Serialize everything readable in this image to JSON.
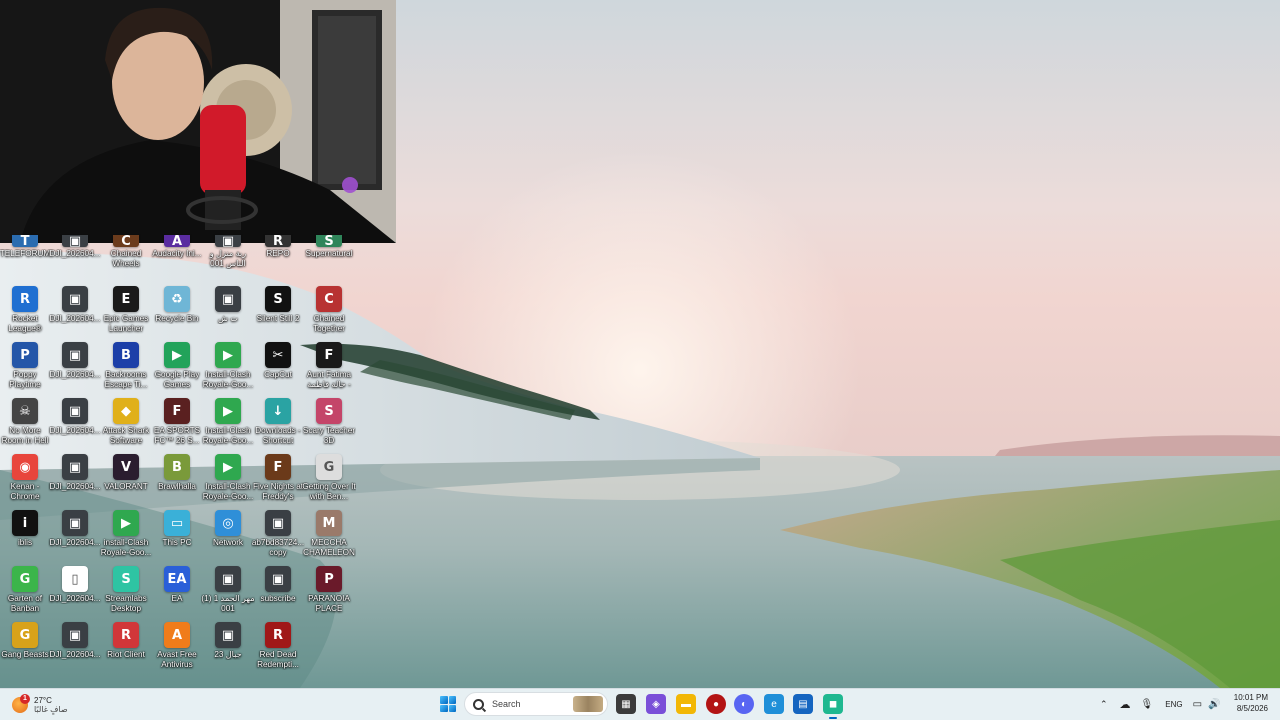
{
  "desktop": {
    "icons": [
      {
        "col": 0,
        "row": 0,
        "label": "TELEFORUM",
        "color": "#2b6cb0",
        "glyph": "T",
        "partial": true
      },
      {
        "col": 1,
        "row": 0,
        "label": "DJI_202604...",
        "color": "#3a3f44",
        "glyph": "▣",
        "partial": true
      },
      {
        "col": 2,
        "row": 0,
        "label": "Chained Wheels",
        "color": "#6b3b1c",
        "glyph": "C",
        "partial": true
      },
      {
        "col": 3,
        "row": 0,
        "label": "Audacity Ini...",
        "color": "#5a2ca0",
        "glyph": "A",
        "partial": true
      },
      {
        "col": 4,
        "row": 0,
        "label": "ربة منزل و الناس 001",
        "color": "#3a3f44",
        "glyph": "▣",
        "partial": true
      },
      {
        "col": 5,
        "row": 0,
        "label": "REPO",
        "color": "#333333",
        "glyph": "R",
        "partial": true
      },
      {
        "col": 6,
        "row": 0,
        "label": "Supernatural",
        "color": "#2f855a",
        "glyph": "S",
        "partial": true
      },
      {
        "col": 0,
        "row": 1,
        "label": "Rocket League®",
        "color": "#1f6fd1",
        "glyph": "R"
      },
      {
        "col": 1,
        "row": 1,
        "label": "DJI_202604...",
        "color": "#3a3f44",
        "glyph": "▣"
      },
      {
        "col": 2,
        "row": 1,
        "label": "Epic Games Launcher",
        "color": "#1a1a1a",
        "glyph": "E"
      },
      {
        "col": 3,
        "row": 1,
        "label": "Recycle Bin",
        "color": "#6fb6d6",
        "glyph": "♻"
      },
      {
        "col": 4,
        "row": 1,
        "label": "ت ش",
        "color": "#3a3f44",
        "glyph": "▣"
      },
      {
        "col": 5,
        "row": 1,
        "label": "Silent Still 2",
        "color": "#111111",
        "glyph": "S"
      },
      {
        "col": 6,
        "row": 1,
        "label": "Chained Together",
        "color": "#b83232",
        "glyph": "C"
      },
      {
        "col": 0,
        "row": 2,
        "label": "Poppy Playtime",
        "color": "#2456a8",
        "glyph": "P"
      },
      {
        "col": 1,
        "row": 2,
        "label": "DJI_202604...",
        "color": "#3a3f44",
        "glyph": "▣"
      },
      {
        "col": 2,
        "row": 2,
        "label": "Backrooms Escape Ti...",
        "color": "#1c3fa8",
        "glyph": "B"
      },
      {
        "col": 3,
        "row": 2,
        "label": "Google Play Games",
        "color": "#22a35a",
        "glyph": "▶"
      },
      {
        "col": 4,
        "row": 2,
        "label": "Install-Clash Royale-Goo...",
        "color": "#2fa84f",
        "glyph": "▶"
      },
      {
        "col": 5,
        "row": 2,
        "label": "CapCut",
        "color": "#111111",
        "glyph": "✂"
      },
      {
        "col": 6,
        "row": 2,
        "label": "Aunt Fatima خالة فاطمة -",
        "color": "#1a1a1a",
        "glyph": "F"
      },
      {
        "col": 0,
        "row": 3,
        "label": "No More Room in Hell",
        "color": "#444444",
        "glyph": "☠"
      },
      {
        "col": 1,
        "row": 3,
        "label": "DJI_202604...",
        "color": "#3a3f44",
        "glyph": "▣"
      },
      {
        "col": 2,
        "row": 3,
        "label": "Attack Shark Software",
        "color": "#e0b01a",
        "glyph": "◆"
      },
      {
        "col": 3,
        "row": 3,
        "label": "EA SPORTS FC™ 26 S...",
        "color": "#5a2020",
        "glyph": "F"
      },
      {
        "col": 4,
        "row": 3,
        "label": "Install-Clash Royale-Goo...",
        "color": "#2fa84f",
        "glyph": "▶"
      },
      {
        "col": 5,
        "row": 3,
        "label": "Downloads - Shortcut",
        "color": "#2aa3a3",
        "glyph": "↓"
      },
      {
        "col": 6,
        "row": 3,
        "label": "Scary Teacher 3D",
        "color": "#c44569",
        "glyph": "S"
      },
      {
        "col": 0,
        "row": 4,
        "label": "Kenan - Chrome",
        "color": "#e8453c",
        "glyph": "◉"
      },
      {
        "col": 1,
        "row": 4,
        "label": "DJI_202604...",
        "color": "#3a3f44",
        "glyph": "▣"
      },
      {
        "col": 2,
        "row": 4,
        "label": "VALORANT",
        "color": "#2b1d2f",
        "glyph": "V"
      },
      {
        "col": 3,
        "row": 4,
        "label": "Brawlhalla",
        "color": "#7a9a3a",
        "glyph": "B"
      },
      {
        "col": 4,
        "row": 4,
        "label": "Install-Clash Royale-Goo...",
        "color": "#2fa84f",
        "glyph": "▶"
      },
      {
        "col": 5,
        "row": 4,
        "label": "Five Nights at Freddy's",
        "color": "#6b3a1a",
        "glyph": "F"
      },
      {
        "col": 6,
        "row": 4,
        "label": "Getting Over It with Ben...",
        "color": "#dddddd",
        "glyph": "G"
      },
      {
        "col": 0,
        "row": 5,
        "label": "iblis",
        "color": "#111111",
        "glyph": "i"
      },
      {
        "col": 1,
        "row": 5,
        "label": "DJI_202604...",
        "color": "#3a3f44",
        "glyph": "▣"
      },
      {
        "col": 2,
        "row": 5,
        "label": "install-Clash Royale-Goo...",
        "color": "#2fa84f",
        "glyph": "▶"
      },
      {
        "col": 3,
        "row": 5,
        "label": "This PC",
        "color": "#3ab0d8",
        "glyph": "▭"
      },
      {
        "col": 4,
        "row": 5,
        "label": "Network",
        "color": "#2f8fd8",
        "glyph": "◎"
      },
      {
        "col": 5,
        "row": 5,
        "label": "ab7bd83724... copy",
        "color": "#3a3f44",
        "glyph": "▣"
      },
      {
        "col": 6,
        "row": 5,
        "label": "MECCHA CHAMELEON",
        "color": "#9a7a6a",
        "glyph": "M"
      },
      {
        "col": 0,
        "row": 6,
        "label": "Garten of Banban",
        "color": "#3bb54a",
        "glyph": "G"
      },
      {
        "col": 1,
        "row": 6,
        "label": "DJI_202604...",
        "color": "#ffffff",
        "glyph": "▯"
      },
      {
        "col": 2,
        "row": 6,
        "label": "Streamlabs Desktop",
        "color": "#2ec4a3",
        "glyph": "S"
      },
      {
        "col": 3,
        "row": 6,
        "label": "EA",
        "color": "#2a5fd8",
        "glyph": "EA"
      },
      {
        "col": 4,
        "row": 6,
        "label": "مهر الحمد 1 (1) 001",
        "color": "#3a3f44",
        "glyph": "▣"
      },
      {
        "col": 5,
        "row": 6,
        "label": "subscribe",
        "color": "#3a3f44",
        "glyph": "▣"
      },
      {
        "col": 6,
        "row": 6,
        "label": "PARANOIA PLACE",
        "color": "#6a1a2a",
        "glyph": "P"
      },
      {
        "col": 0,
        "row": 7,
        "label": "Gang Beasts",
        "color": "#d8a21a",
        "glyph": "G"
      },
      {
        "col": 1,
        "row": 7,
        "label": "DJI_202604...",
        "color": "#3a3f44",
        "glyph": "▣"
      },
      {
        "col": 2,
        "row": 7,
        "label": "Riot Client",
        "color": "#d13639",
        "glyph": "R"
      },
      {
        "col": 3,
        "row": 7,
        "label": "Avast Free Antivirus",
        "color": "#f07c1a",
        "glyph": "A"
      },
      {
        "col": 4,
        "row": 7,
        "label": "جبال 23",
        "color": "#3a3f44",
        "glyph": "▣"
      },
      {
        "col": 5,
        "row": 7,
        "label": "Red Dead Redempti...",
        "color": "#a01818",
        "glyph": "R"
      }
    ]
  },
  "taskbar": {
    "weather": {
      "temp": "27°C",
      "desc": "صافٍ غالبًا",
      "badge": "1"
    },
    "search_placeholder": "Search",
    "apps": [
      {
        "name": "file-manager",
        "color": "#3b3b3b",
        "glyph": "▦"
      },
      {
        "name": "colorful-app",
        "color": "#7a4fd8",
        "glyph": "◈"
      },
      {
        "name": "folder",
        "color": "#f2b705",
        "glyph": "▬"
      },
      {
        "name": "red-app",
        "color": "#b31414",
        "glyph": "●"
      },
      {
        "name": "discord",
        "color": "#5865f2",
        "glyph": "◐"
      },
      {
        "name": "edge",
        "color": "#1f8fd8",
        "glyph": "e"
      },
      {
        "name": "store",
        "color": "#1565c0",
        "glyph": "▤"
      },
      {
        "name": "streamlabs",
        "color": "#1fb890",
        "glyph": "◼"
      }
    ],
    "tray": {
      "language": "ENG"
    },
    "clock": {
      "time": "10:01 PM",
      "date": "8/5/2026"
    }
  }
}
